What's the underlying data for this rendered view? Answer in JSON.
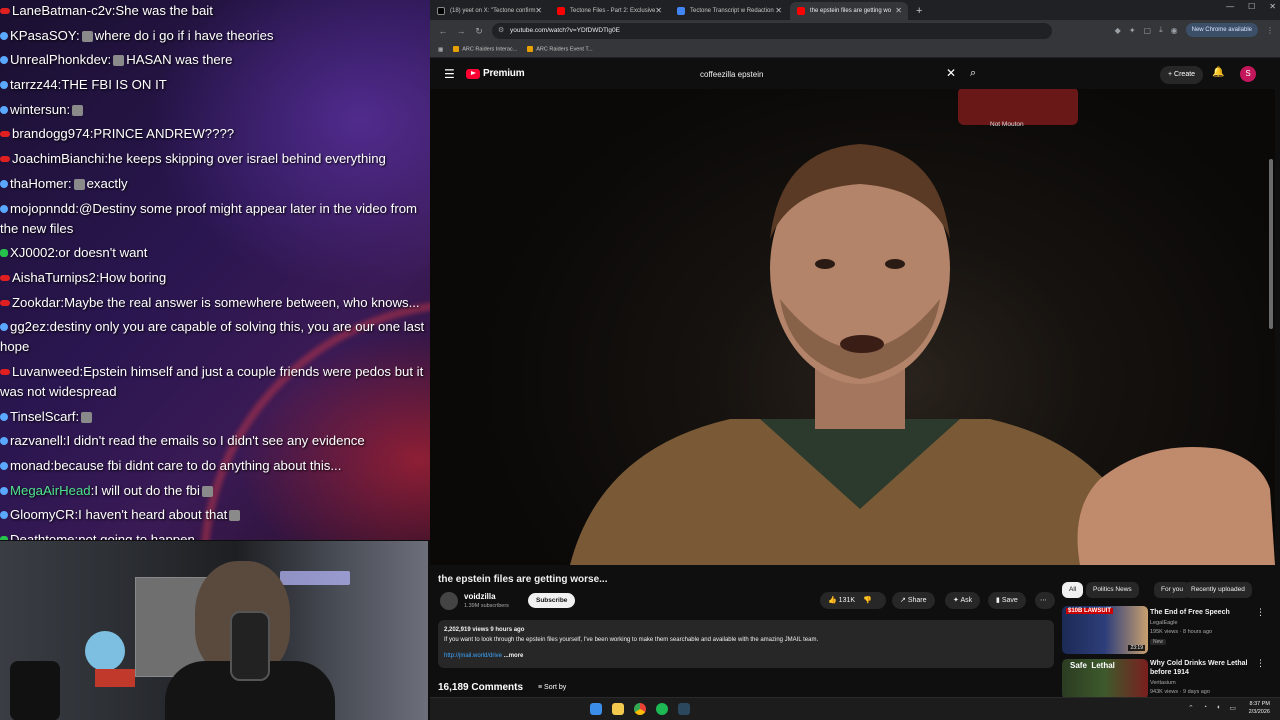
{
  "chat": [
    {
      "badge": "red",
      "user": "LaneBatman-c2v",
      "message": "She was the bait"
    },
    {
      "badge": "blue",
      "user": "KPasaSOY",
      "message": "where do i go if i have theories",
      "emote_before": true
    },
    {
      "badge": "blue",
      "user": "UnrealPhonkdev",
      "message": "HASAN was there",
      "emote_before": true
    },
    {
      "badge": "blue",
      "user": "tarrzz44",
      "message": "THE FBI IS ON IT"
    },
    {
      "badge": "blue",
      "user": "wintersun",
      "message": "",
      "emote_before": true
    },
    {
      "badge": "red",
      "user": "brandogg974",
      "message": "PRINCE ANDREW????"
    },
    {
      "badge": "red",
      "user": "JoachimBianchi",
      "message": "he keeps skipping over israel behind everything"
    },
    {
      "badge": "blue",
      "user": "thaHomer",
      "message": "exactly",
      "emote_before": true
    },
    {
      "badge": "blue",
      "user": "mojopnndd",
      "message": "@Destiny some proof might appear later in the video from the new files"
    },
    {
      "badge": "green",
      "user": "XJ0002",
      "message": "or doesn't want"
    },
    {
      "badge": "red",
      "user": "AishaTurnips2",
      "message": "How boring"
    },
    {
      "badge": "red",
      "user": "Zookdar",
      "message": "Maybe the real answer is somewhere between, who knows..."
    },
    {
      "badge": "blue",
      "user": "gg2ez",
      "message": "destiny only you are capable of solving this, you are our one last hope"
    },
    {
      "badge": "red",
      "user": "Luvanweed",
      "message": "Epstein himself and just a couple friends were pedos but it was not widespread"
    },
    {
      "badge": "blue",
      "user": "TinselScarf",
      "message": "",
      "emote_before": true
    },
    {
      "badge": "blue",
      "user": "razvanell",
      "message": "I didn't read the emails so I didn't see any evidence"
    },
    {
      "badge": "blue",
      "user": "monad",
      "message": "because fbi didnt care to do anything about this..."
    },
    {
      "badge": "blue",
      "user": "MegaAirHead",
      "message": "I will out do the fbi",
      "user_green": true,
      "emote_after": true
    },
    {
      "badge": "blue",
      "user": "GloomyCR",
      "message": "I haven't heard about that",
      "emote_after": true
    },
    {
      "badge": "green",
      "user": "Deathtome",
      "message": "not going to happen"
    }
  ],
  "browser": {
    "tabs": [
      {
        "label": "(18) yeet on X: \"Tectone confirm",
        "color": "#ffffff"
      },
      {
        "label": "Tectone Files - Part 2: Exclusive",
        "color": "#ff0000"
      },
      {
        "label": "Tectone Transcript w Redaction",
        "color": "#4285f4"
      },
      {
        "label": "the epstein files are getting wo",
        "color": "#ff0000"
      }
    ],
    "url": "youtube.com/watch?v=YDfDWDTlg0E",
    "bookmarks": [
      "ARC Raiders Interac...",
      "ARC Raiders Event T..."
    ],
    "update_label": "New Chrome available"
  },
  "youtube": {
    "logo_text": "Premium",
    "search_query": "coffeezilla epstein",
    "create_label": "Create",
    "avatar_letter": "S",
    "overlay_caption": "Not Mouton",
    "video": {
      "title": "the epstein files are getting worse...",
      "channel": "voidzilla",
      "subscribers": "1.39M subscribers",
      "subscribe_label": "Subscribe",
      "likes": "131K",
      "share_label": "Share",
      "ask_label": "Ask",
      "save_label": "Save",
      "stats": "2,202,919 views  9 hours ago",
      "description": "If you want to look through the epstein files yourself, I've been working to make them searchable and available with the amazing JMAIL team.",
      "link": "http://jmail.world/drive",
      "more_label": "...more",
      "comments": "16,189 Comments",
      "sort_label": "Sort by"
    },
    "chips": [
      "All",
      "Politics News",
      "For you",
      "Recently uploaded"
    ],
    "recommendations": [
      {
        "title": "The End of Free Speech",
        "channel": "LegalEagle",
        "meta": "195K views · 8 hours ago",
        "badge": "New",
        "duration": "23:19",
        "thumb_text": "$10B LAWSUIT"
      },
      {
        "title": "Why Cold Drinks Were Lethal before 1914",
        "channel": "Veritasium",
        "meta": "943K views · 9 days ago",
        "thumb_text": "Safe  Lethal"
      }
    ]
  },
  "taskbar": {
    "time": "8:37 PM",
    "date": "2/3/2026"
  }
}
